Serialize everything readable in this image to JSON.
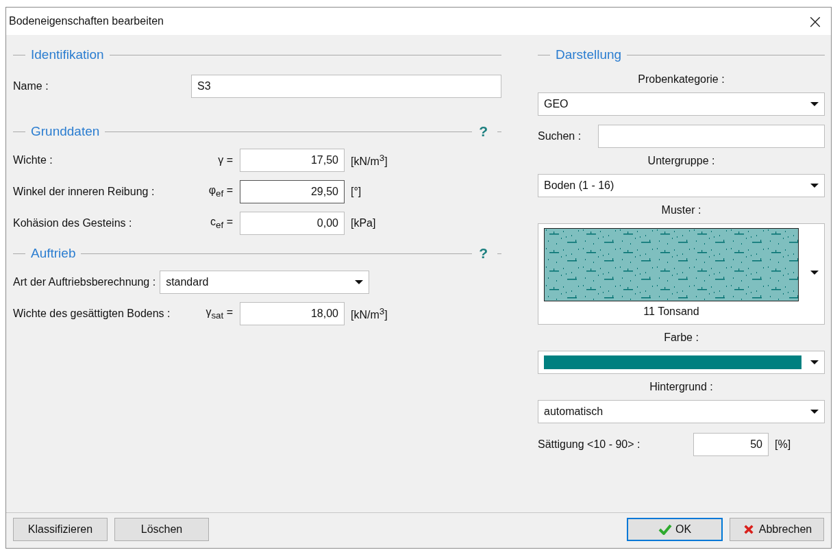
{
  "window": {
    "title": "Bodeneigenschaften bearbeiten",
    "close": "×"
  },
  "identification": {
    "title": "Identifikation",
    "name_label": "Name :",
    "name_value": "S3"
  },
  "basic": {
    "title": "Grunddaten",
    "help": "?",
    "rows": [
      {
        "label": "Wichte :",
        "symbol": "γ =",
        "value": "17,50",
        "unit": "[kN/m$^{3}$]",
        "focused": false
      },
      {
        "label": "Winkel der inneren Reibung :",
        "symbol": "φ$_{ef}$ =",
        "value": "29,50",
        "unit": "[°]",
        "focused": true
      },
      {
        "label": "Kohäsion des Gesteins :",
        "symbol": "c$_{ef}$ =",
        "value": "0,00",
        "unit": "[kPa]",
        "focused": false
      }
    ]
  },
  "buoyancy": {
    "title": "Auftrieb",
    "help": "?",
    "type_label": "Art der Auftriebsberechnung :",
    "type_value": "standard",
    "rows": [
      {
        "label": "Wichte des gesättigten Bodens :",
        "symbol": "γ$_{sat}$ =",
        "value": "18,00",
        "unit": "[kN/m$^{3}$]",
        "focused": false
      }
    ]
  },
  "display": {
    "title": "Darstellung",
    "category_label": "Probenkategorie :",
    "category_value": "GEO",
    "search_label": "Suchen :",
    "subgroup_label": "Untergruppe :",
    "subgroup_value": "Boden (1 - 16)",
    "pattern_label": "Muster :",
    "pattern_caption": "11 Tonsand",
    "color_label": "Farbe :",
    "color": "#008080",
    "background_label": "Hintergrund :",
    "background_value": "automatisch",
    "saturation_label": "Sättigung <10 - 90> :",
    "saturation_value": "50",
    "saturation_unit": "[%]"
  },
  "buttons": [
    {
      "label": "Klassifizieren",
      "kind": "plain",
      "default": false
    },
    {
      "label": "Löschen",
      "kind": "plain",
      "default": false
    },
    {
      "label": "OK",
      "kind": "ok",
      "default": true
    },
    {
      "label": "Abbrechen",
      "kind": "cancel",
      "default": false
    }
  ]
}
